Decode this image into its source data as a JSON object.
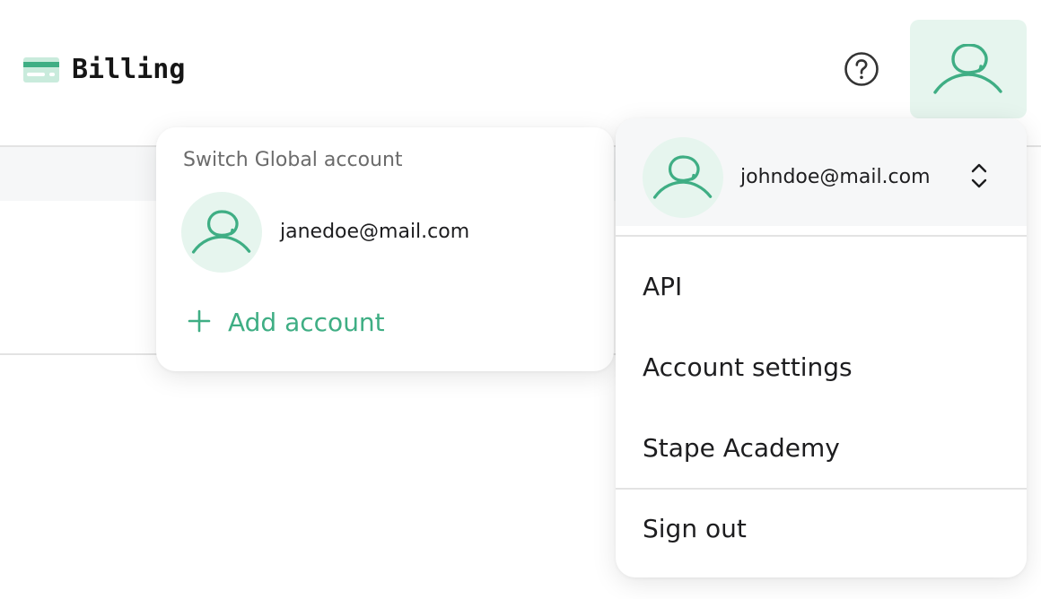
{
  "header": {
    "title": "Billing",
    "billing_icon": "credit-card-icon",
    "help_icon": "question-circle-icon",
    "user_icon": "user-icon"
  },
  "account_switcher": {
    "title": "Switch Global account",
    "accounts": [
      {
        "email": "janedoe@mail.com"
      }
    ],
    "add_account_label": "Add account"
  },
  "user_menu": {
    "current_email": "johndoe@mail.com",
    "items": [
      {
        "label": "API"
      },
      {
        "label": "Account settings"
      },
      {
        "label": "Stape Academy"
      }
    ],
    "sign_out_label": "Sign out"
  },
  "colors": {
    "accent": "#3fae84",
    "avatar_bg": "#e6f5ee",
    "panel_gray": "#f6f7f8"
  }
}
